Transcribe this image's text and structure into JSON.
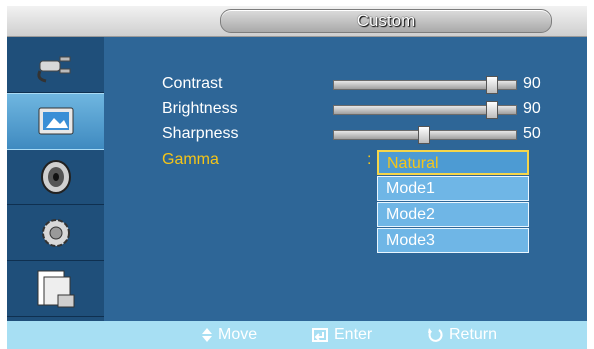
{
  "title": "Custom",
  "sidebar": {
    "items": [
      {
        "icon": "input-plug-icon"
      },
      {
        "icon": "picture-icon",
        "active": true
      },
      {
        "icon": "sound-icon"
      },
      {
        "icon": "settings-gear-icon"
      },
      {
        "icon": "multi-screen-icon"
      }
    ]
  },
  "settings": [
    {
      "label": "Contrast",
      "value": "90",
      "level": 90
    },
    {
      "label": "Brightness",
      "value": "90",
      "level": 90
    },
    {
      "label": "Sharpness",
      "value": "50",
      "level": 50
    }
  ],
  "gamma": {
    "label": "Gamma",
    "colon": ":",
    "options": [
      "Natural",
      "Mode1",
      "Mode2",
      "Mode3"
    ],
    "selected": "Natural"
  },
  "footer": {
    "move": "Move",
    "enter": "Enter",
    "return": "Return"
  },
  "colors": {
    "panel": "#2e6697",
    "sidebar": "#1f4f7a",
    "highlight": "#f5c518",
    "footer": "#a7dff3"
  }
}
